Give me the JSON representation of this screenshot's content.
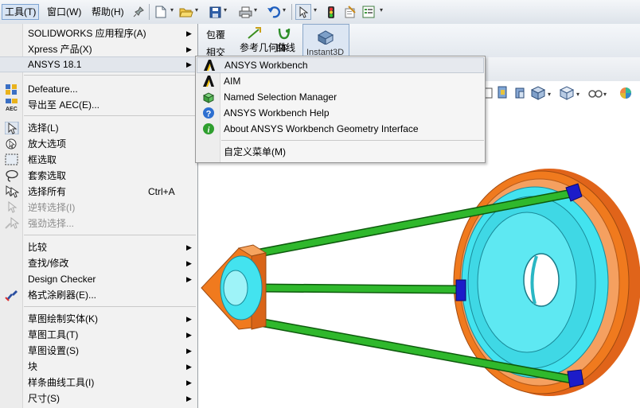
{
  "menubar": {
    "items": [
      {
        "label": "工具(T)",
        "active": true
      },
      {
        "label": "窗口(W)"
      },
      {
        "label": "帮助(H)"
      }
    ]
  },
  "toolbar": {
    "icons": [
      "pin-icon",
      "new-document-icon",
      "open-folder-icon",
      "save-icon",
      "print-icon",
      "undo-icon",
      "select-pointer-icon",
      "traffic-light-icon",
      "options-icon",
      "file-properties-icon"
    ]
  },
  "ribbon": {
    "wrap_label": "包覆",
    "intersect_label": "相交",
    "ref_geometry_label": "参考几何体",
    "curves_label": "曲线",
    "instant3d_label": "Instant3D"
  },
  "main_menu": {
    "items": [
      {
        "label": "SOLIDWORKS 应用程序(A)",
        "submenu": true
      },
      {
        "label": "Xpress 产品(X)",
        "submenu": true
      },
      {
        "label": "ANSYS 18.1",
        "submenu": true,
        "highlighted": true
      },
      {
        "label": "Defeature...",
        "icon": "defeature-icon"
      },
      {
        "label": "导出至 AEC(E)...",
        "icon": "aec-export-icon"
      },
      {
        "label": "选择(L)",
        "icon": "select-arrow-icon"
      },
      {
        "label": "放大选项",
        "icon": "magnify-select-icon"
      },
      {
        "label": "框选取",
        "icon": "box-select-icon"
      },
      {
        "label": "套索选取",
        "icon": "lasso-select-icon"
      },
      {
        "label": "选择所有",
        "shortcut": "Ctrl+A",
        "icon": "select-all-icon"
      },
      {
        "label": "逆转选择(I)",
        "disabled": true,
        "icon": "invert-select-icon"
      },
      {
        "label": "强劲选择...",
        "disabled": true,
        "icon": "power-select-icon"
      },
      {
        "label": "比较",
        "submenu": true
      },
      {
        "label": "查找/修改",
        "submenu": true
      },
      {
        "label": "Design Checker",
        "submenu": true
      },
      {
        "label": "格式涂刷器(E)...",
        "icon": "format-painter-icon"
      },
      {
        "label": "草图绘制实体(K)",
        "submenu": true
      },
      {
        "label": "草图工具(T)",
        "submenu": true
      },
      {
        "label": "草图设置(S)",
        "submenu": true
      },
      {
        "label": "块",
        "submenu": true
      },
      {
        "label": "样条曲线工具(I)",
        "submenu": true
      },
      {
        "label": "尺寸(S)",
        "submenu": true
      }
    ]
  },
  "submenu": {
    "items": [
      {
        "label": "ANSYS Workbench",
        "icon": "ansys-logo-icon",
        "highlighted": true
      },
      {
        "label": "AIM",
        "icon": "ansys-logo-icon"
      },
      {
        "label": "Named Selection Manager",
        "icon": "named-selection-icon"
      },
      {
        "label": "ANSYS Workbench Help",
        "icon": "help-icon"
      },
      {
        "label": "About ANSYS Workbench Geometry Interface",
        "icon": "info-icon"
      },
      {
        "label": "自定义菜单(M)"
      }
    ]
  },
  "colors": {
    "accent_highlight": "#e2e6ec",
    "belt_green": "#2fb82c",
    "pulley_orange": "#f07a1e",
    "pulley_cyan": "#43e3ef",
    "blue_clip": "#1c1cc9"
  }
}
